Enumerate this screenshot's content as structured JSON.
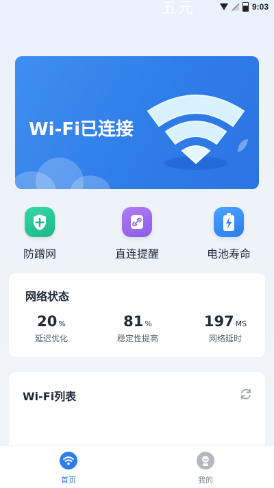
{
  "status_bar": {
    "ghost_text": "五元",
    "time": "9:03"
  },
  "banner": {
    "title": "Wi-Fi已连接"
  },
  "actions": [
    {
      "label": "防蹭网",
      "icon": "shield-plus-icon"
    },
    {
      "label": "直连提醒",
      "icon": "link-icon"
    },
    {
      "label": "电池寿命",
      "icon": "battery-icon"
    }
  ],
  "network_status": {
    "title": "网络状态",
    "metrics": [
      {
        "value": "20",
        "unit": "%",
        "caption": "延迟优化"
      },
      {
        "value": "81",
        "unit": "%",
        "caption": "稳定性提高"
      },
      {
        "value": "197",
        "unit": "MS",
        "caption": "网络延时"
      }
    ]
  },
  "wifi_list": {
    "title": "Wi-Fi列表"
  },
  "bottom_nav": [
    {
      "label": "首页",
      "icon": "wifi-home-icon",
      "active": true
    },
    {
      "label": "我的",
      "icon": "profile-icon",
      "active": false
    }
  ],
  "colors": {
    "accent": "#2f7de9",
    "active_tab": "#2f7de9",
    "inactive_tab": "#7a818c"
  }
}
